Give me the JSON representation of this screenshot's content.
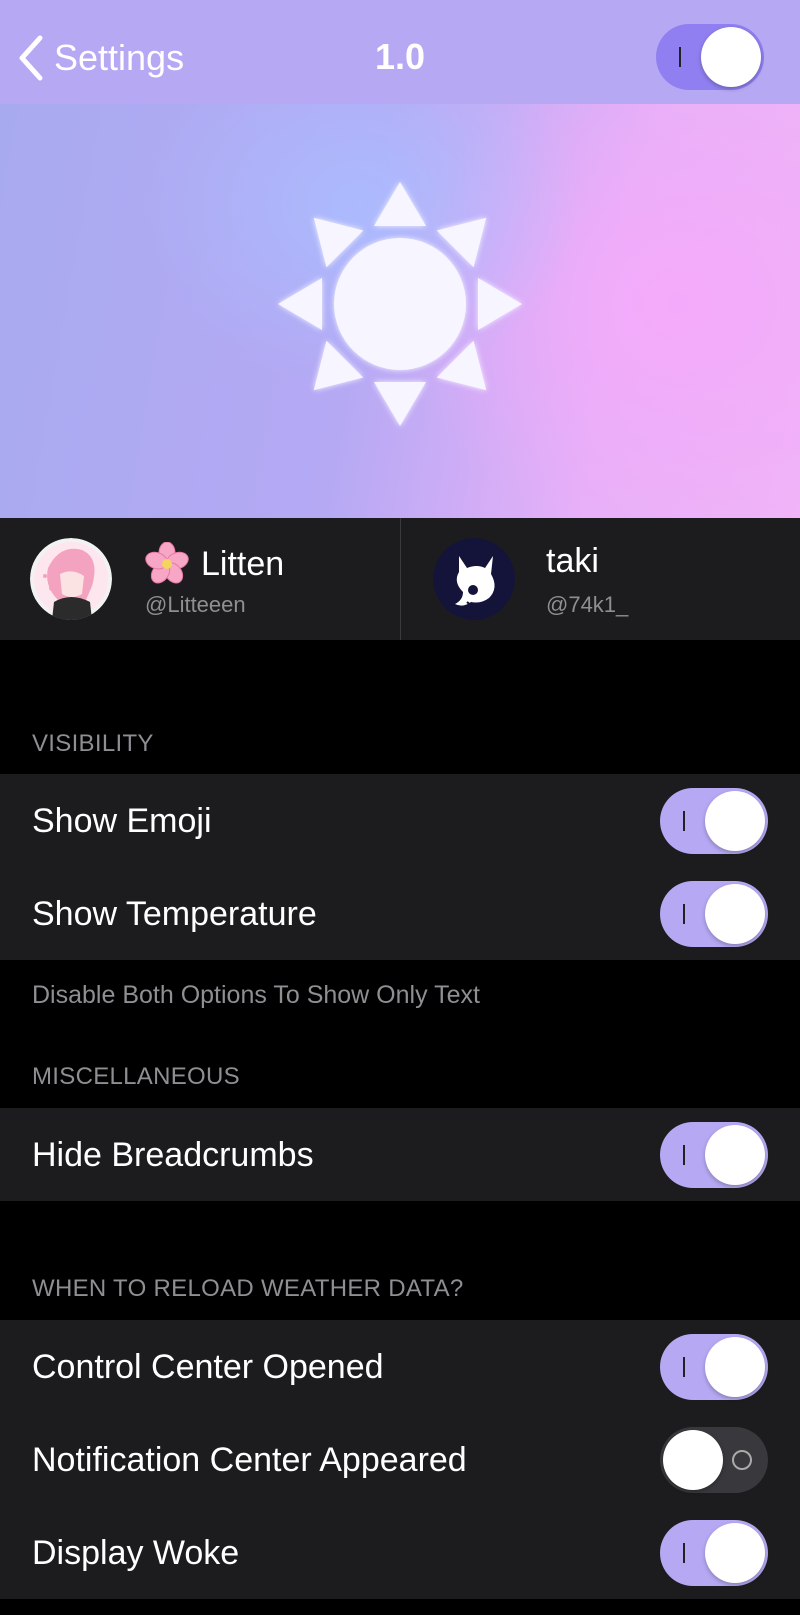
{
  "nav": {
    "back_label": "Settings",
    "title": "1.0",
    "enabled": true
  },
  "banner": {
    "icon": "sun-icon"
  },
  "credits": [
    {
      "name": "Litten",
      "handle": "@Litteeen",
      "emoji": "cherry-blossom-icon"
    },
    {
      "name": "taki",
      "handle": "@74k1_"
    }
  ],
  "sections": {
    "visibility": {
      "header": "VISIBILITY",
      "footer": "Disable Both Options To Show Only Text",
      "items": [
        {
          "label": "Show Emoji",
          "on": true
        },
        {
          "label": "Show Temperature",
          "on": true
        }
      ]
    },
    "misc": {
      "header": "MISCELLANEOUS",
      "items": [
        {
          "label": "Hide Breadcrumbs",
          "on": true
        }
      ]
    },
    "reload": {
      "header": "WHEN TO RELOAD WEATHER DATA?",
      "items": [
        {
          "label": "Control Center Opened",
          "on": true
        },
        {
          "label": "Notification Center Appeared",
          "on": false
        },
        {
          "label": "Display Woke",
          "on": true
        }
      ]
    }
  },
  "colors": {
    "accent": "#b6a8f3",
    "cell_bg": "#1c1c1e",
    "secondary_text": "#8e8e93",
    "toggle_off": "#39393d"
  }
}
